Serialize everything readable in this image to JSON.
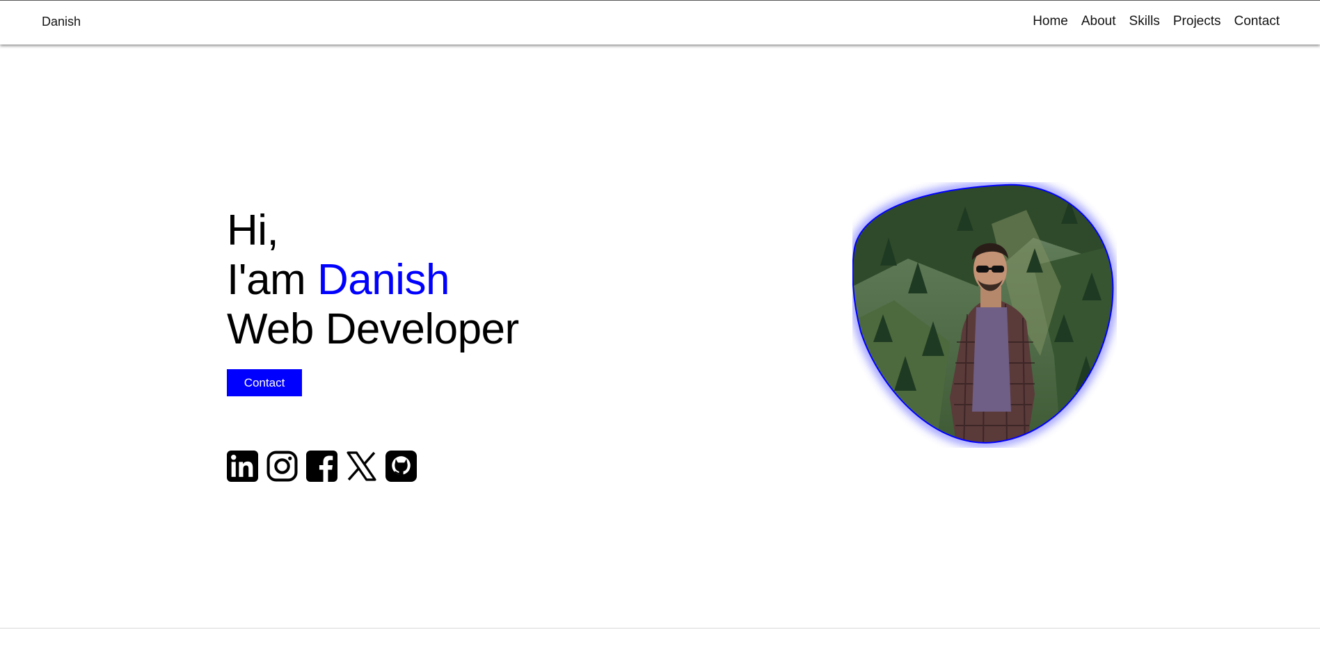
{
  "navbar": {
    "brand": "Danish",
    "links": [
      {
        "label": "Home"
      },
      {
        "label": "About"
      },
      {
        "label": "Skills"
      },
      {
        "label": "Projects"
      },
      {
        "label": "Contact"
      }
    ]
  },
  "hero": {
    "greeting": "Hi,",
    "intro_prefix": "I'am",
    "name": "Danish",
    "role": "Web Developer",
    "contact_button": "Contact"
  },
  "socials": [
    {
      "icon": "linkedin-icon"
    },
    {
      "icon": "instagram-icon"
    },
    {
      "icon": "facebook-icon"
    },
    {
      "icon": "x-icon"
    },
    {
      "icon": "github-icon"
    }
  ],
  "colors": {
    "accent": "#0000ff",
    "text": "#000000",
    "background": "#ffffff"
  }
}
